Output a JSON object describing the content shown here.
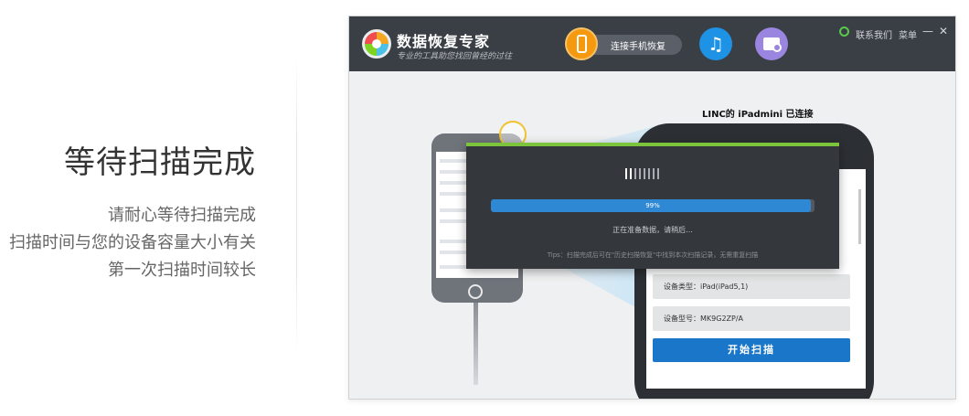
{
  "promo": {
    "title": "等待扫描完成",
    "lines": [
      "请耐心等待扫描完成",
      "扫描时间与您的设备容量大小有关",
      "第一次扫描时间较长"
    ]
  },
  "app": {
    "name": "数据恢复专家",
    "slogan": "专业的工具助您找回曾经的过往",
    "tabs": {
      "phone_label": "连接手机恢复",
      "itunes_icon": "music-note-icon",
      "history_icon": "folder-clock-icon"
    },
    "window_controls": {
      "contact": "联系我们",
      "menu": "菜单",
      "minimize": "—",
      "close": "✕"
    }
  },
  "device": {
    "title": "LINC的 iPadmini 已连接",
    "type_label": "设备类型：",
    "type_value": "iPad(iPad5,1)",
    "model_label": "设备型号：",
    "model_value": "MK9G2ZP/A",
    "start_button": "开始扫描"
  },
  "scan_dialog": {
    "progress_percent": 99,
    "progress_text": "99%",
    "status": "正在准备数据，请稍后...",
    "tips": "Tips：扫描完成后可在\"历史扫描恢复\"中找到本次扫描记录，无需重复扫描"
  },
  "colors": {
    "titlebar": "#3a3e45",
    "accent_orange": "#f59a10",
    "accent_blue": "#1a76c9",
    "progress_green": "#7cc43b"
  }
}
